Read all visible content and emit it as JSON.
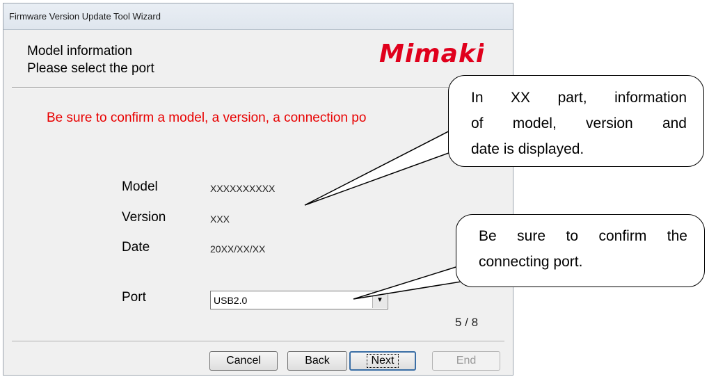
{
  "window": {
    "title": "Firmware Version Update Tool Wizard"
  },
  "header": {
    "line1": "Model information",
    "line2": "Please select the port",
    "logo": "MIMAKI",
    "logo_color": "#e0001c"
  },
  "warning": {
    "text": "Be sure to confirm a model, a version, a connection po",
    "color": "#e80000"
  },
  "info": {
    "model_label": "Model",
    "model_value": "XXXXXXXXXX",
    "version_label": "Version",
    "version_value": "XXX",
    "date_label": "Date",
    "date_value": "20XX/XX/XX"
  },
  "port": {
    "label": "Port",
    "selected": "USB2.0"
  },
  "progress": {
    "text": "5 / 8"
  },
  "buttons": {
    "cancel": "Cancel",
    "back": "Back",
    "next": "Next",
    "end": "End"
  },
  "callouts": {
    "info": {
      "lines": [
        "In  XX  part,  information",
        "of  model,  version  and",
        "date is displayed."
      ]
    },
    "port": {
      "lines": [
        "Be  sure  to  confirm  the",
        "connecting port."
      ]
    }
  }
}
